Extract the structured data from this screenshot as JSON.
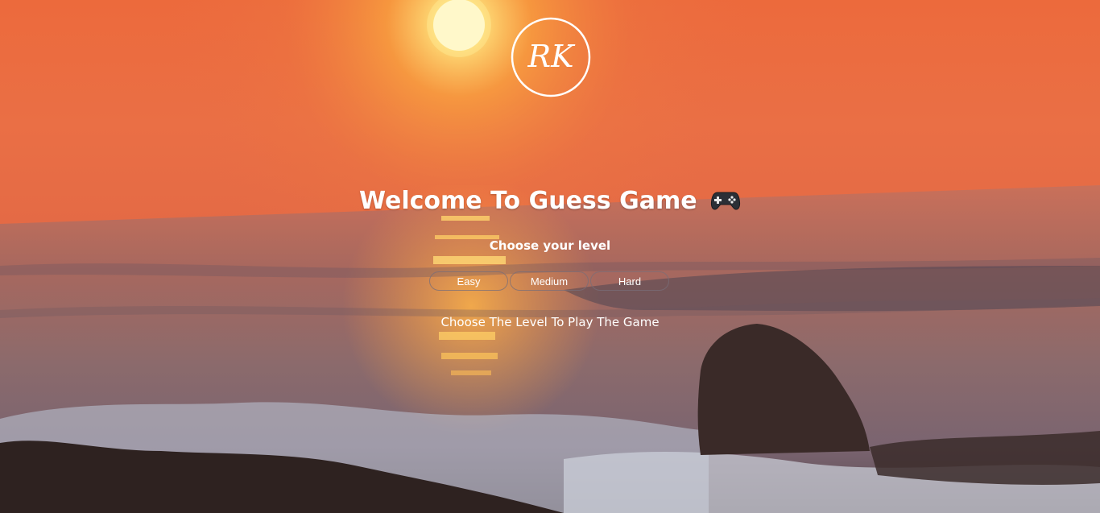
{
  "logo": {
    "text": "RK"
  },
  "header": {
    "title": "Welcome To Guess Game",
    "title_icon": "game-controller-icon"
  },
  "level_section": {
    "prompt": "Choose your level",
    "options": [
      "Easy",
      "Medium",
      "Hard"
    ]
  },
  "status": {
    "message": "Choose The Level To Play The Game"
  },
  "colors": {
    "sky_top": "#e8683a",
    "sun": "#fff6c8",
    "sea": "#8a5a4a",
    "text": "#ffffff"
  }
}
